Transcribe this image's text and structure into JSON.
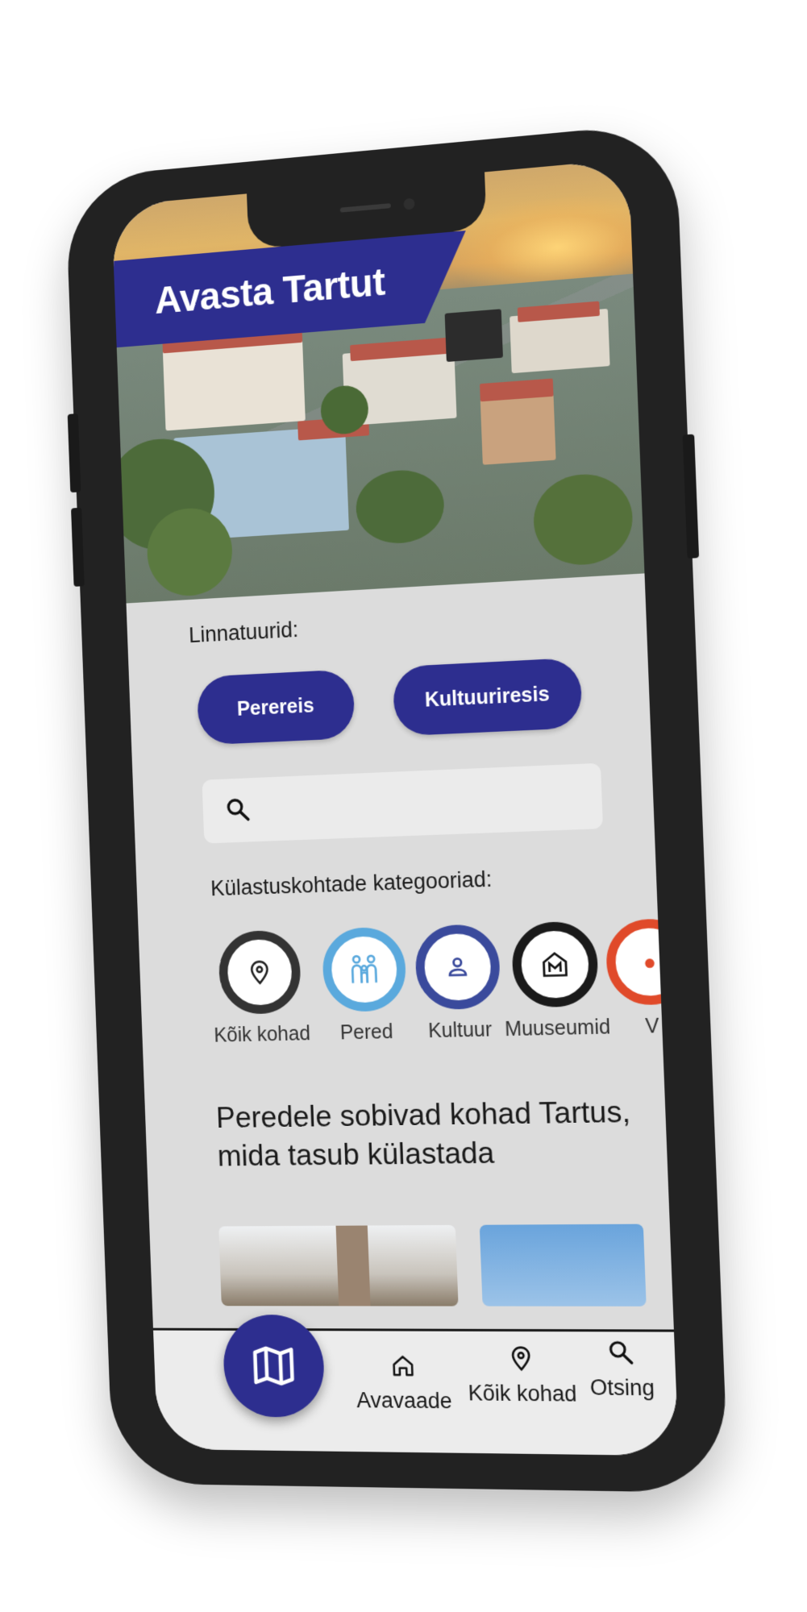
{
  "hero": {
    "title": "Avasta Tartut"
  },
  "tours": {
    "label": "Linnatuurid:",
    "buttons": [
      "Perereis",
      "Kultuuriresis"
    ]
  },
  "search": {
    "icon": "search-icon",
    "placeholder": ""
  },
  "categories": {
    "label": "Külastuskohtade kategooriad:",
    "items": [
      {
        "label": "Kõik kohad",
        "icon": "location-pin-icon",
        "ring": "#333333"
      },
      {
        "label": "Pered",
        "icon": "family-icon",
        "ring": "#5aa9dd"
      },
      {
        "label": "Kultuur",
        "icon": "person-icon",
        "ring": "#3a4a9c"
      },
      {
        "label": "Muuseumid",
        "icon": "museum-icon",
        "ring": "#1a1a1a"
      },
      {
        "label": "V",
        "icon": "category-icon",
        "ring": "#e04a2a"
      }
    ]
  },
  "section": {
    "heading": "Peredele sobivad kohad Tartus, mida tasub külastada"
  },
  "nav": {
    "map_icon": "map-icon",
    "items": [
      {
        "label": "Avavaade",
        "icon": "home-icon"
      },
      {
        "label": "Kõik kohad",
        "icon": "location-pin-icon"
      },
      {
        "label": "Otsing",
        "icon": "search-icon"
      }
    ]
  },
  "colors": {
    "primary": "#2d2e8f",
    "background": "#dcdcdc",
    "frame": "#222222"
  }
}
